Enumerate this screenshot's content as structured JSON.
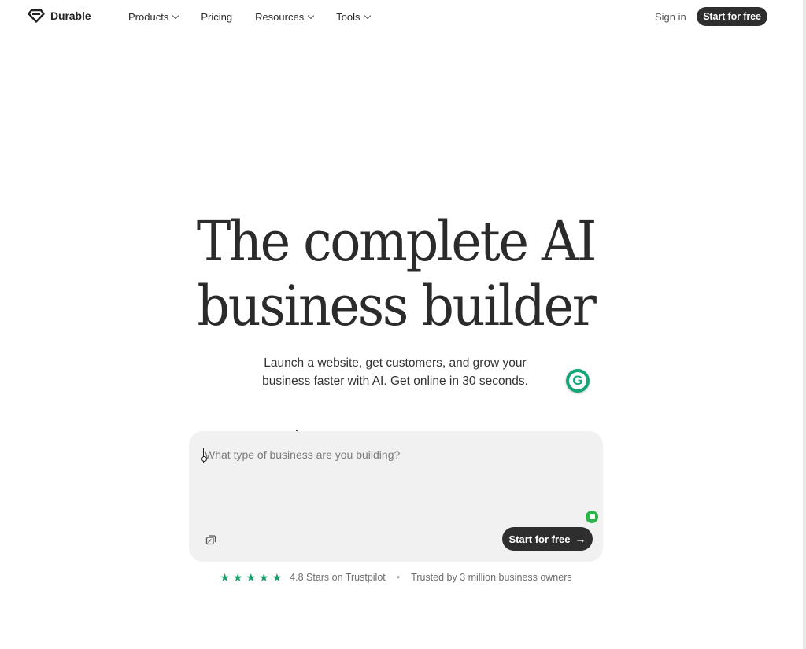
{
  "nav": {
    "brand": "Durable",
    "links": [
      {
        "label": "Products",
        "has_dropdown": true
      },
      {
        "label": "Pricing",
        "has_dropdown": false
      },
      {
        "label": "Resources",
        "has_dropdown": true
      },
      {
        "label": "Tools",
        "has_dropdown": true
      }
    ],
    "signin": "Sign in",
    "cta": "Start for free"
  },
  "hero": {
    "title_line1": "The complete AI",
    "title_line2": "business builder",
    "subtitle_line1": "Launch a website, get customers, and grow your",
    "subtitle_line2": "business faster with AI. Get online in 30 seconds."
  },
  "prompt": {
    "placeholder": "What type of business are you building?",
    "value": "",
    "cta": "Start for free",
    "cta_arrow": "→"
  },
  "extension": {
    "letter": "G"
  },
  "rating": {
    "stars": 5,
    "star_glyph": "★",
    "text": "4.8 Stars on Trustpilot",
    "separator": "•",
    "trust": "Trusted by 3 million business owners"
  },
  "colors": {
    "cta_bg": "#2e2e2e",
    "star": "#1a9e6a",
    "extension": "#13a67a",
    "prompt_bg": "#f1f1f1"
  }
}
